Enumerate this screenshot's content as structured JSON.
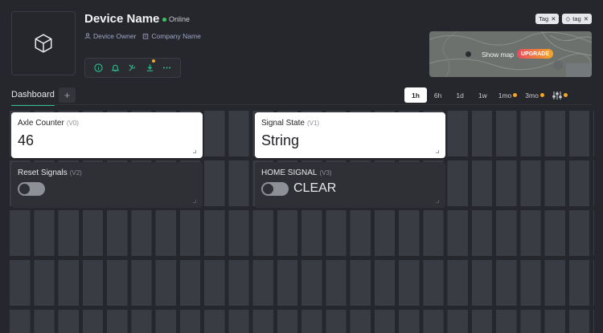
{
  "device": {
    "name": "Device Name",
    "status": "Online",
    "owner": "Device Owner",
    "company": "Company Name"
  },
  "toolbar": {
    "icons": [
      "info-icon",
      "bell-icon",
      "wrench-icon",
      "download-icon",
      "more-icon"
    ]
  },
  "tags": [
    {
      "label": "Tag"
    },
    {
      "label": "tag"
    }
  ],
  "map": {
    "show_label": "Show map",
    "upgrade_label": "UPGRADE"
  },
  "tabs": {
    "dashboard": "Dashboard",
    "add": "+"
  },
  "time_range": {
    "options": [
      "1h",
      "6h",
      "1d",
      "1w",
      "1mo",
      "3mo"
    ],
    "active": "1h"
  },
  "widgets": {
    "axle_counter": {
      "title": "Axle Counter",
      "pin": "(V0)",
      "value": "46"
    },
    "signal_state": {
      "title": "Signal State",
      "pin": "(V1)",
      "value": "String"
    },
    "reset_signals": {
      "title": "Reset Signals",
      "pin": "(V2)"
    },
    "home_signal": {
      "title": "HOME SIGNAL",
      "pin": "(V3)",
      "state_label": "CLEAR"
    }
  },
  "colors": {
    "accent": "#2fbf8f",
    "online": "#3cc46a",
    "warning": "#f5a623",
    "background": "#26272c"
  }
}
